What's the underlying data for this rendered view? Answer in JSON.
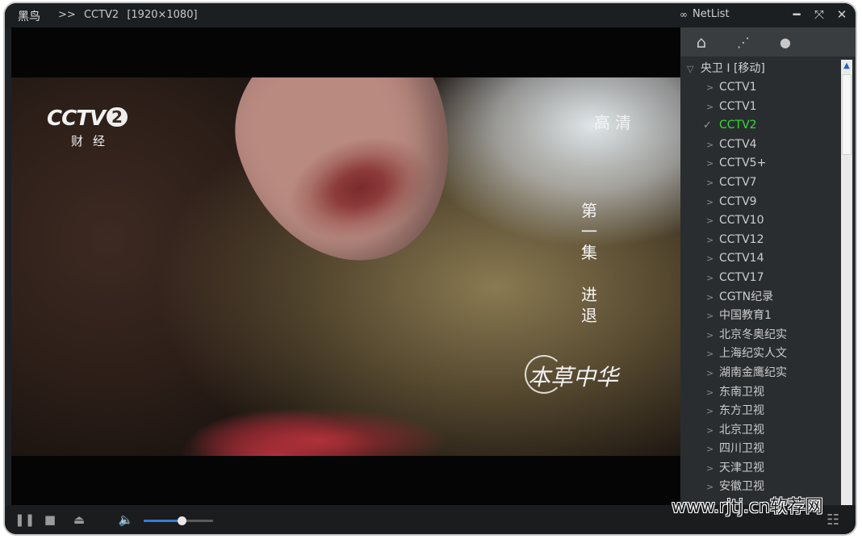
{
  "titlebar": {
    "app_name": "黑鸟",
    "prefix": ">>",
    "channel": "CCTV2",
    "resolution": "[1920×1080]",
    "netlist_label": "NetList",
    "icons": [
      "link-icon",
      "minimize-icon",
      "fullscreen-icon",
      "close-icon"
    ]
  },
  "video": {
    "logo_text": "CCTV",
    "logo_number": "2",
    "logo_sub": "财经",
    "hd_label": "高清",
    "episode_chars": [
      "第",
      "一",
      "集",
      "进",
      "退"
    ],
    "series_title": "本草中华"
  },
  "panel": {
    "tabs": [
      {
        "icon": "home-icon",
        "glyph": "⌂"
      },
      {
        "icon": "share-icon",
        "glyph": "⋰"
      },
      {
        "icon": "user-icon",
        "glyph": "●"
      }
    ],
    "group_label": "央卫 I [移动]",
    "items": [
      "CCTV1",
      "CCTV1",
      "CCTV2",
      "CCTV4",
      "CCTV5+",
      "CCTV7",
      "CCTV9",
      "CCTV10",
      "CCTV12",
      "CCTV14",
      "CCTV17",
      "CGTN纪录",
      "中国教育1",
      "北京冬奥纪实",
      "上海纪实人文",
      "湖南金鹰纪实",
      "东南卫视",
      "东方卫视",
      "北京卫视",
      "四川卫视",
      "天津卫视",
      "安徽卫视"
    ],
    "active_index": 2
  },
  "controls": {
    "volume": 0.55,
    "icons": [
      "pause-icon",
      "stop-icon",
      "eject-icon",
      "volume-icon",
      "playlist-icon"
    ]
  },
  "watermark": "www.rjtj.cn软荐网",
  "colors": {
    "active_channel": "#2fe02f",
    "volume_fill": "#3a7bd5",
    "scroll_arrow": "#2060c0"
  }
}
